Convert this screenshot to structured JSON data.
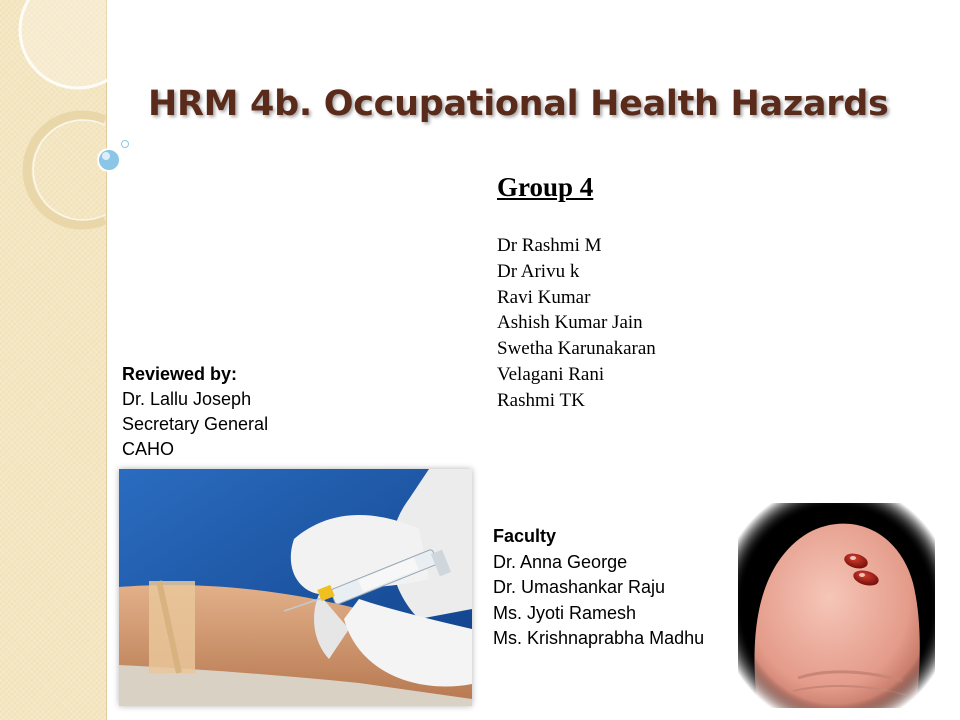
{
  "slide": {
    "title": "HRM 4b. Occupational Health Hazards"
  },
  "group": {
    "heading": "Group 4",
    "members": [
      "Dr Rashmi M",
      "Dr Arivu k",
      "Ravi Kumar",
      "Ashish Kumar Jain",
      "Swetha Karunakaran",
      "Velagani Rani",
      "Rashmi TK"
    ]
  },
  "reviewed": {
    "heading": "Reviewed by:",
    "lines": [
      "Dr. Lallu Joseph",
      "Secretary General",
      "CAHO"
    ]
  },
  "faculty": {
    "heading": "Faculty",
    "lines": [
      "Dr. Anna George",
      "Dr. Umashankar Raju",
      "Ms. Jyoti Ramesh",
      "Ms. Krishnaprabha Madhu"
    ]
  },
  "colors": {
    "title": "#5a2a1a",
    "side_panel": "#f4e6c1",
    "accent_bubble": "#8cc6e6"
  }
}
